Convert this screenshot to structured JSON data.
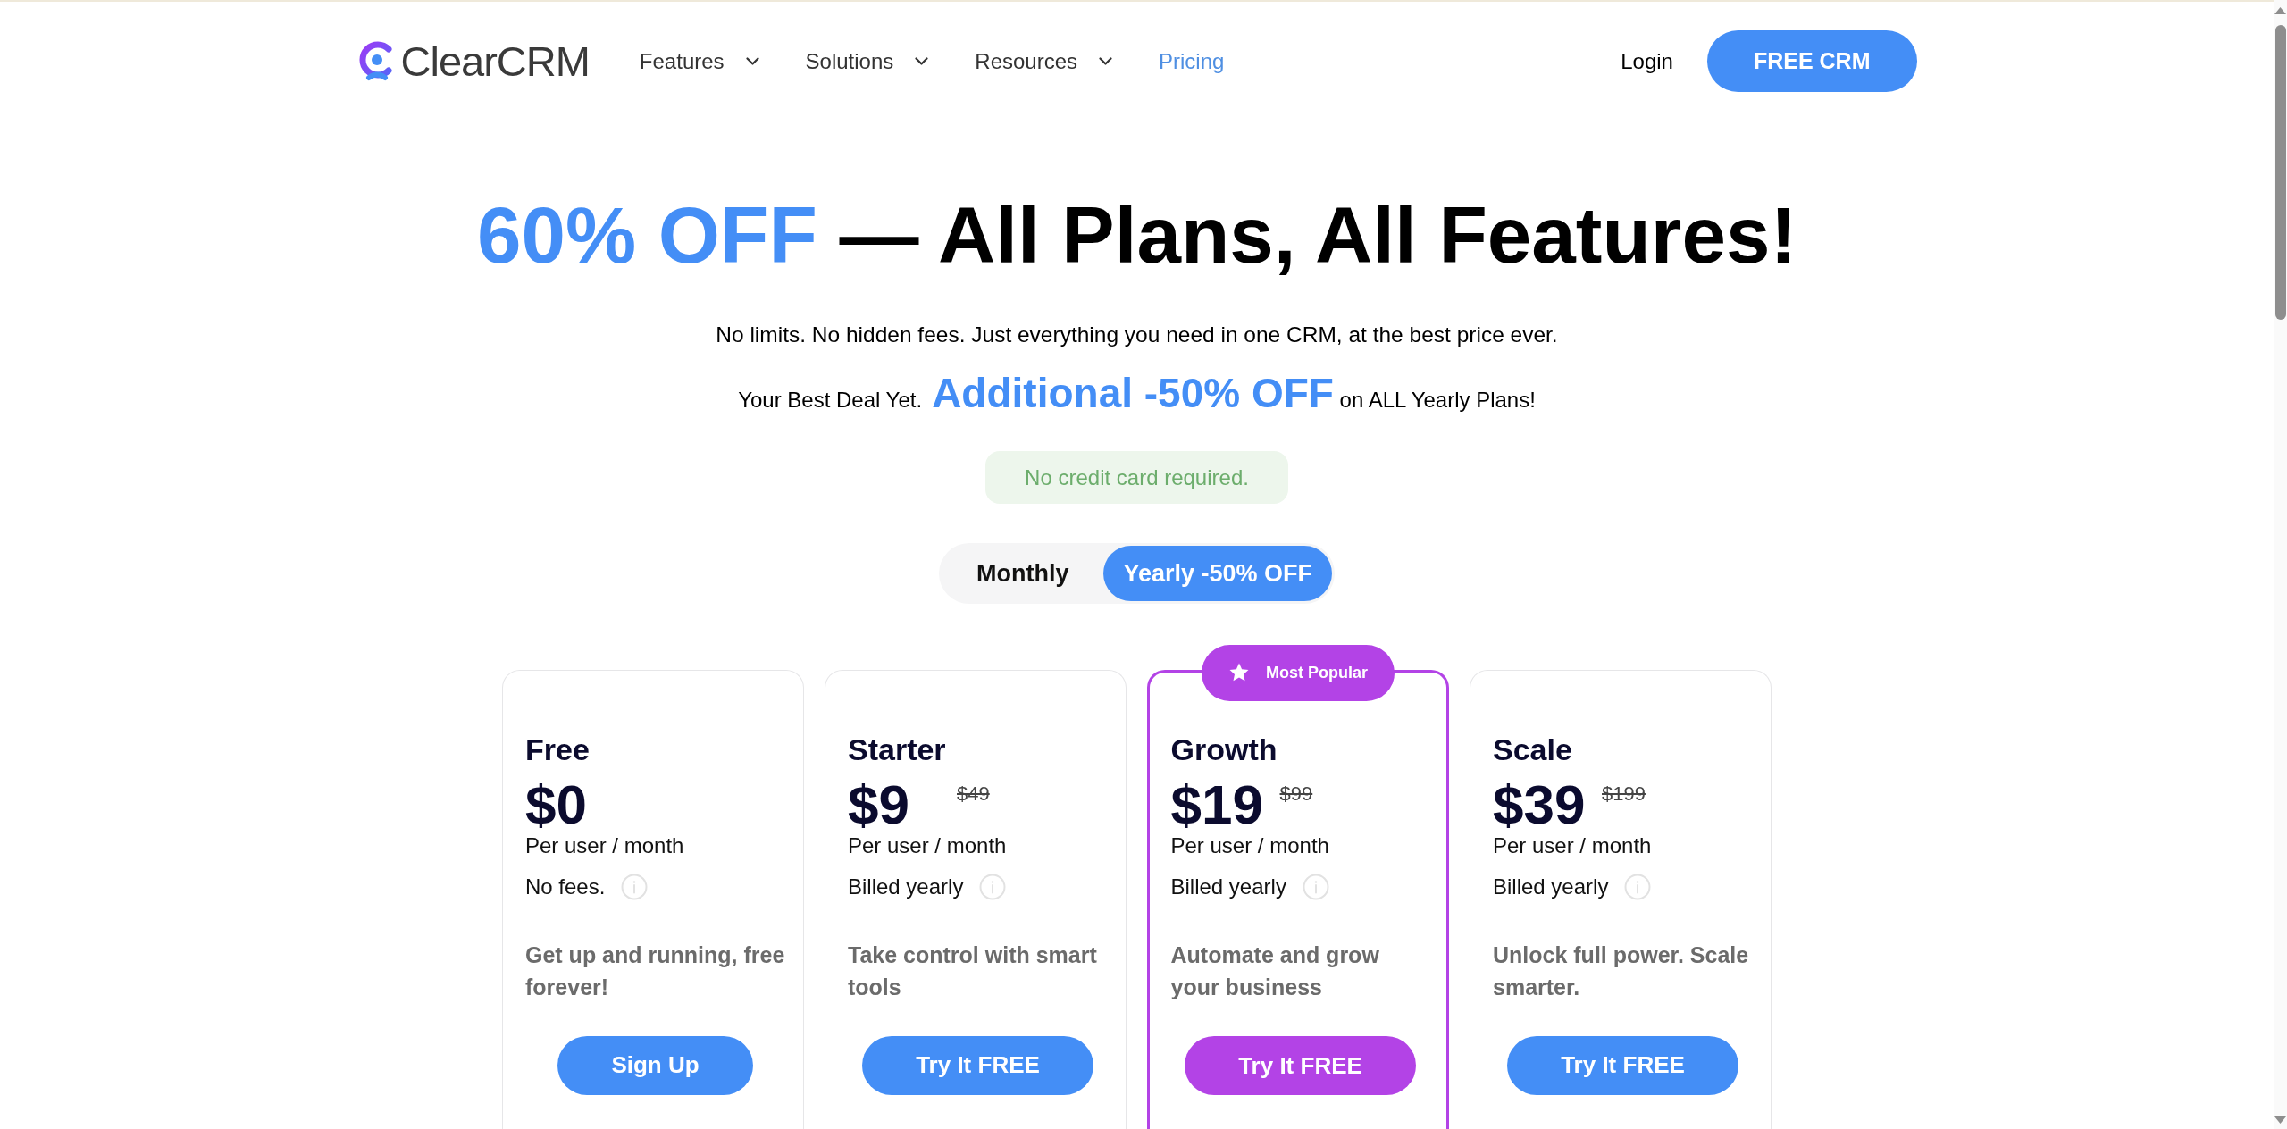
{
  "header": {
    "logo_text": "ClearCRM",
    "nav": [
      {
        "label": "Features",
        "dropdown": true,
        "selected": false
      },
      {
        "label": "Solutions",
        "dropdown": true,
        "selected": false
      },
      {
        "label": "Resources",
        "dropdown": true,
        "selected": false
      },
      {
        "label": "Pricing",
        "dropdown": false,
        "selected": true
      }
    ],
    "login": "Login",
    "cta": "FREE CRM"
  },
  "hero": {
    "title_highlight": "60% OFF",
    "title_text": "— All Plans, All Features!",
    "subtitle": "No limits. No hidden fees. Just everything you need in one CRM, at the best price ever.",
    "deal": {
      "lead": "Your Best Deal Yet.",
      "highlight": "Additional -50% OFF",
      "tail": "on ALL Yearly Plans!"
    },
    "note": "No credit card required."
  },
  "billing_toggle": [
    {
      "label": "Monthly",
      "selected": false
    },
    {
      "label": "Yearly -50% OFF",
      "selected": true
    }
  ],
  "plans": [
    {
      "name": "Free",
      "price": "$0",
      "period": "Per user / month",
      "billing": "No fees.",
      "description": "Get up and running, free forever!",
      "button": "Sign Up",
      "featured": false
    },
    {
      "name": "Starter",
      "price": "$9",
      "old_price": "$49",
      "period": "Per user / month",
      "billing": "Billed yearly",
      "description": "Take control with smart tools",
      "button": "Try It FREE",
      "featured": false
    },
    {
      "name": "Growth",
      "price": "$19",
      "old_price": "$99",
      "period": "Per user / month",
      "billing": "Billed yearly",
      "description": "Automate and grow your business",
      "button": "Try It FREE",
      "featured": true,
      "badge": "Most Popular"
    },
    {
      "name": "Scale",
      "price": "$39",
      "old_price": "$199",
      "period": "Per user / month",
      "billing": "Billed yearly",
      "description": "Unlock full power. Scale smarter.",
      "button": "Try It FREE",
      "featured": false
    }
  ]
}
